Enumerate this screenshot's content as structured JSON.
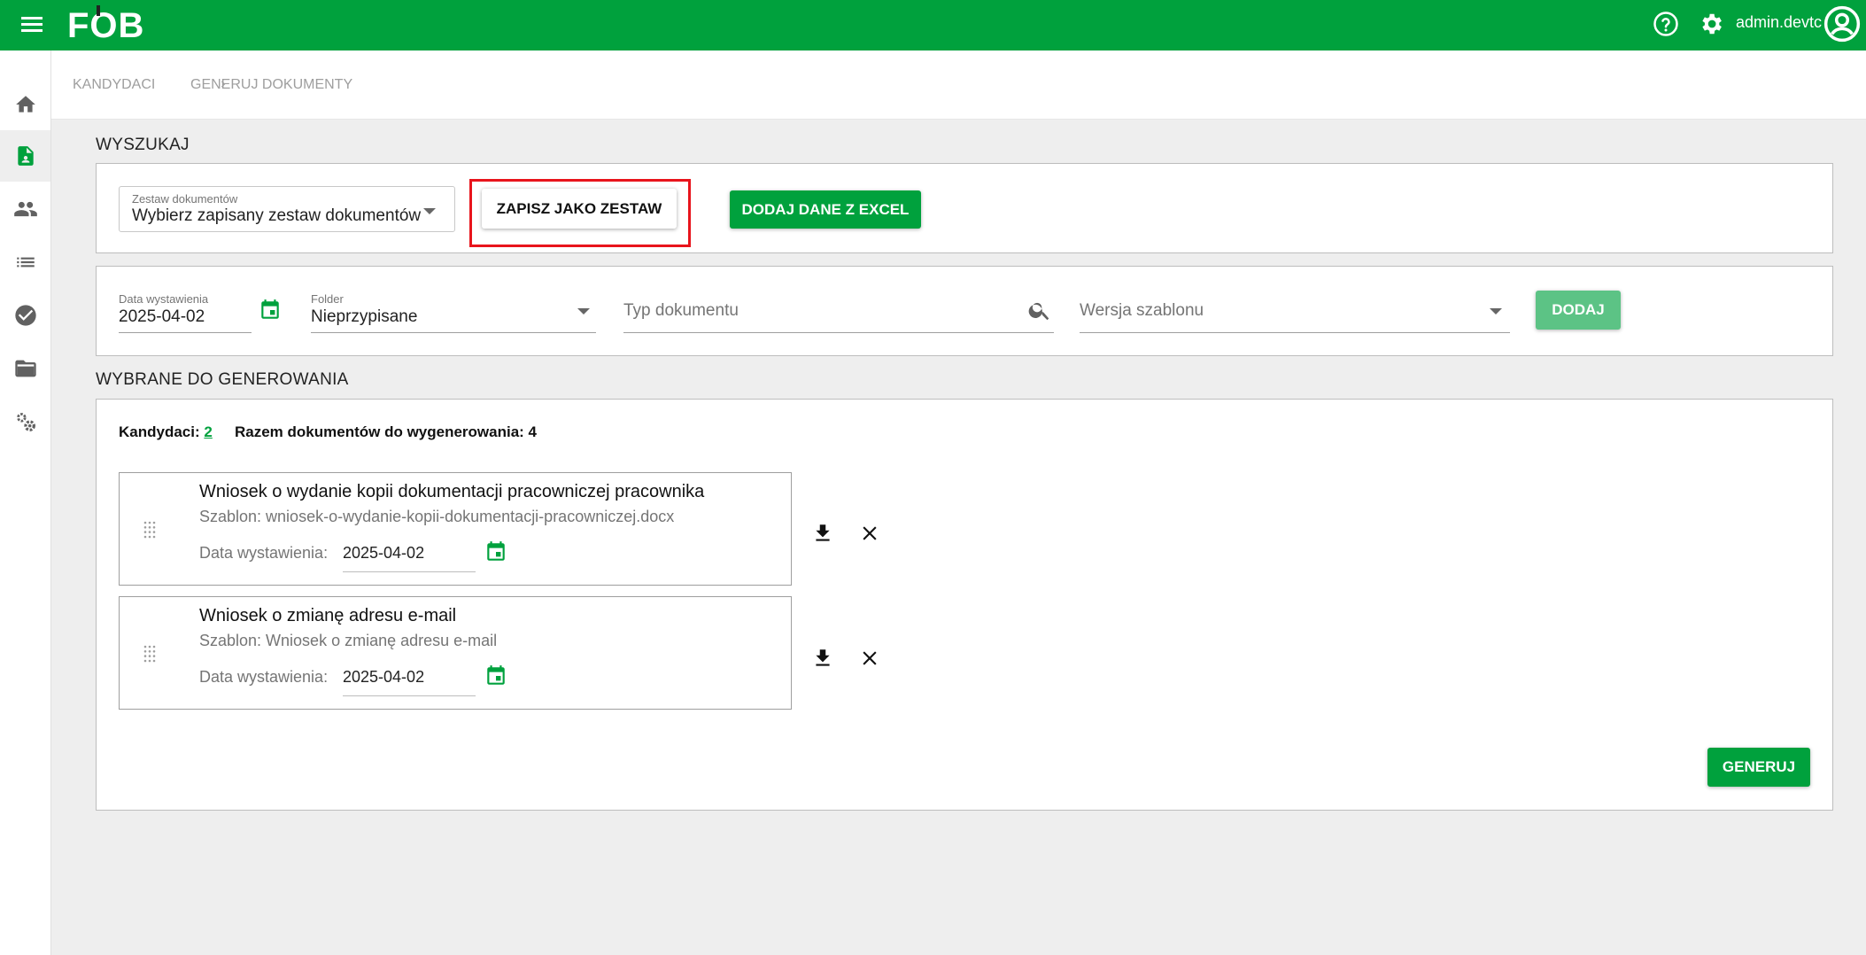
{
  "app": {
    "logo": "FOB",
    "user": "admin.devtc"
  },
  "breadcrumb": {
    "items": [
      "KANDYDACI",
      "GENERUJ DOKUMENTY"
    ]
  },
  "search": {
    "title": "WYSZUKAJ",
    "set_select": {
      "label": "Zestaw dokumentów",
      "value": "Wybierz zapisany zestaw dokumentów"
    },
    "save_set_button": "ZAPISZ JAKO ZESTAW",
    "excel_button": "DODAJ DANE Z EXCEL"
  },
  "filters": {
    "date": {
      "label": "Data wystawienia",
      "value": "2025-04-02"
    },
    "folder": {
      "label": "Folder",
      "value": "Nieprzypisane"
    },
    "doc_type": {
      "placeholder": "Typ dokumentu"
    },
    "template_version": {
      "placeholder": "Wersja szablonu"
    },
    "add_button": "DODAJ"
  },
  "selected": {
    "title": "WYBRANE DO GENEROWANIA",
    "candidates_label": "Kandydaci:",
    "candidates_count": "2",
    "total_label": "Razem dokumentów do wygenerowania: 4",
    "documents": [
      {
        "title": "Wniosek o wydanie kopii dokumentacji pracowniczej pracownika",
        "template": "Szablon: wniosek-o-wydanie-kopii-dokumentacji-pracowniczej.docx",
        "date_label": "Data wystawienia:",
        "date": "2025-04-02"
      },
      {
        "title": "Wniosek o zmianę adresu e-mail",
        "template": "Szablon: Wniosek o zmianę adresu e-mail",
        "date_label": "Data wystawienia:",
        "date": "2025-04-02"
      }
    ],
    "generate_button": "GENERUJ"
  },
  "colors": {
    "brand": "#00a13d",
    "highlight": "#e8141c"
  }
}
